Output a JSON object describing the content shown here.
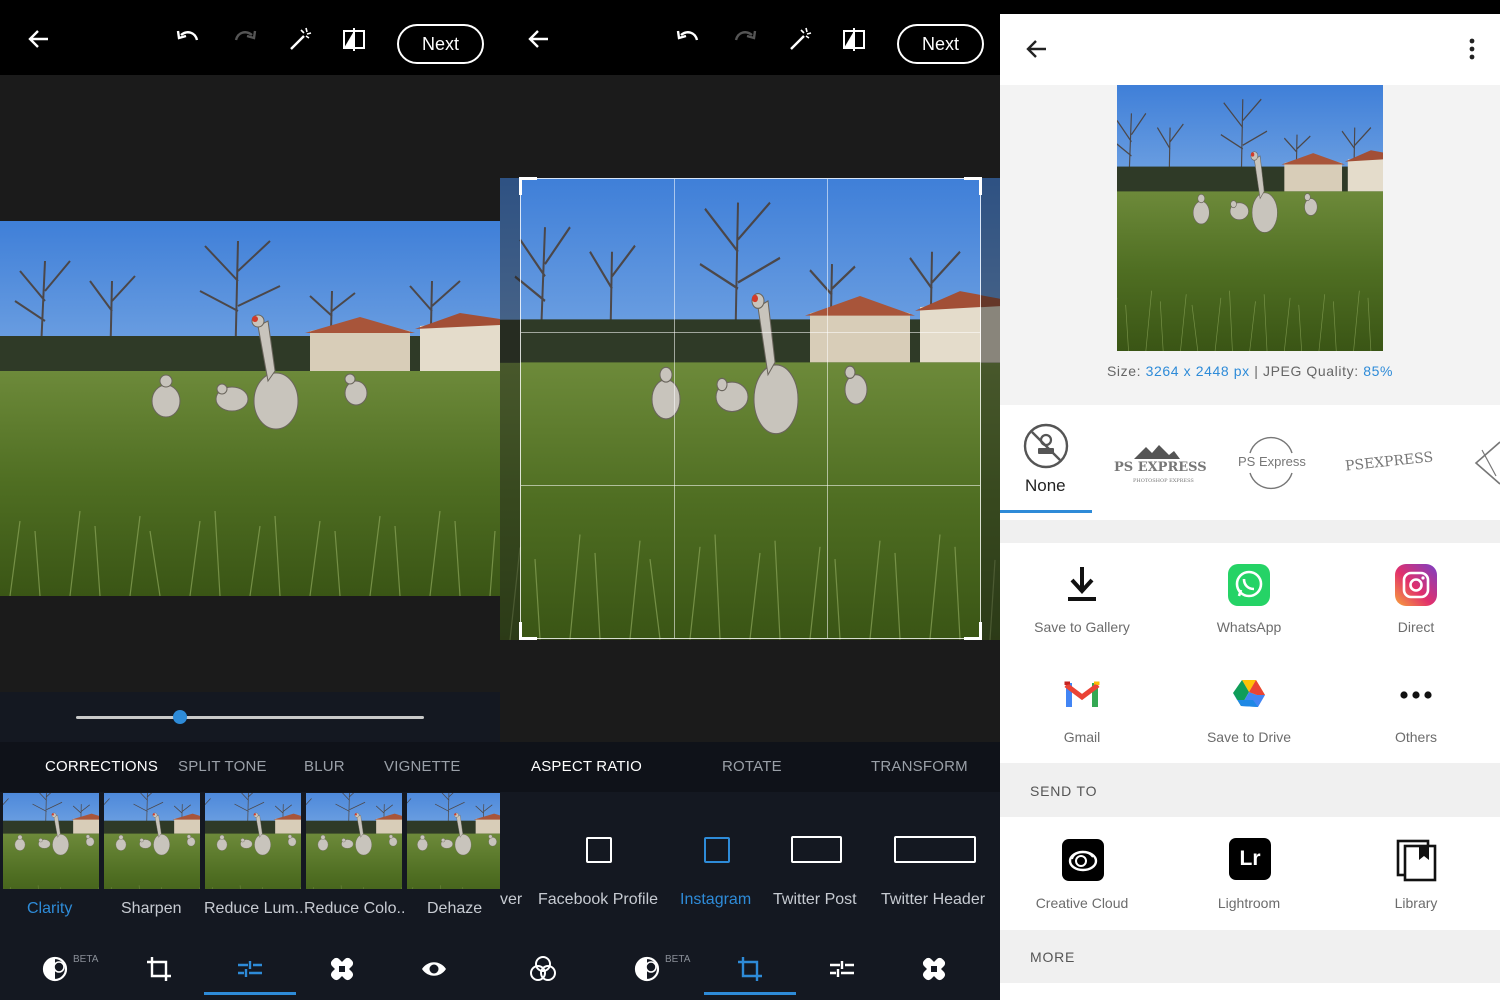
{
  "left_editor": {
    "next_label": "Next",
    "tabs": [
      "CORRECTIONS",
      "SPLIT TONE",
      "BLUR",
      "VIGNETTE"
    ],
    "active_tab": "CORRECTIONS",
    "slider_value_fraction": 0.3,
    "presets": [
      "Clarity",
      "Sharpen",
      "Reduce Lum..",
      "Reduce Colo..",
      "Dehaze"
    ],
    "active_preset": "Clarity",
    "beta_label": "BETA"
  },
  "crop_editor": {
    "next_label": "Next",
    "tabs": [
      "ASPECT RATIO",
      "ROTATE",
      "TRANSFORM"
    ],
    "active_tab": "ASPECT RATIO",
    "partial_label": "ver",
    "ratios": [
      "Facebook Profile",
      "Instagram",
      "Twitter Post",
      "Twitter Header"
    ],
    "active_ratio": "Instagram",
    "beta_label": "BETA"
  },
  "share_screen": {
    "size_prefix": "Size: ",
    "size_value": "3264 x 2448 px",
    "quality_prefix": " | JPEG Quality: ",
    "quality_value": "85%",
    "watermark_none": "None",
    "watermark_1": "PS EXPRESS",
    "watermark_1_sub": "PHOTOSHOP EXPRESS",
    "watermark_2": "PS Express",
    "watermark_3": "PSEXPRESS",
    "share_targets": [
      "Save to Gallery",
      "WhatsApp",
      "Direct",
      "Gmail",
      "Save to Drive",
      "Others"
    ],
    "send_to_title": "SEND TO",
    "send_targets": [
      "Creative Cloud",
      "Lightroom",
      "Library"
    ],
    "lightroom_glyph": "Lr",
    "more_title": "MORE"
  },
  "colors": {
    "accent": "#2e8bd8",
    "whatsapp": "#25d366",
    "dark_bg": "#141821"
  }
}
